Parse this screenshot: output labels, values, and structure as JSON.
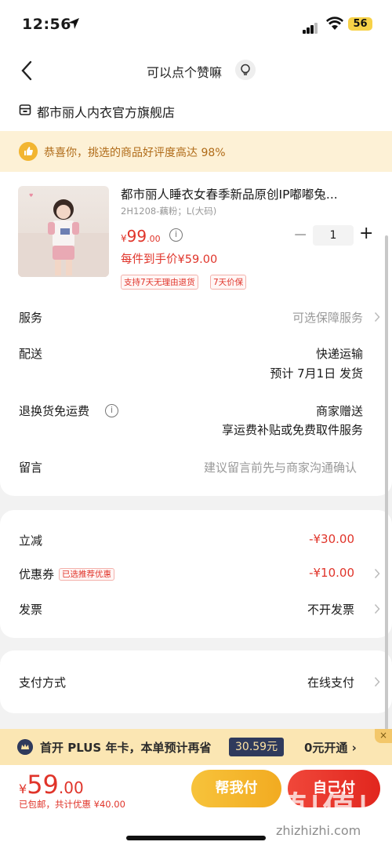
{
  "status": {
    "time": "12:56",
    "battery": "56"
  },
  "nav": {
    "title": "可以点个赞嘛"
  },
  "shop": {
    "name": "都市丽人内衣官方旗舰店"
  },
  "notice": {
    "text": "恭喜你，挑选的商品好评度高达 98%"
  },
  "product": {
    "title": "都市丽人睡衣女春季新品原创IP嘟嘟兔...",
    "sku": "2H1208-藕粉；L(大码)",
    "price_symbol": "¥",
    "price_int": "99",
    "price_dec": ".00",
    "quantity": "1",
    "each_price": "每件到手价¥59.00",
    "tags": [
      "支持7天无理由退货",
      "7天价保"
    ]
  },
  "rows": {
    "service_label": "服务",
    "service_value": "可选保障服务",
    "delivery_label": "配送",
    "delivery_value": "快递运输",
    "delivery_date": "预计 7月1日 发货",
    "return_label": "退换货免运费",
    "return_value": "商家赠送",
    "return_value2": "享运费补贴或免费取件服务",
    "note_label": "留言",
    "note_placeholder": "建议留言前先与商家沟通确认"
  },
  "discounts": {
    "reduce_label": "立减",
    "reduce_value": "-¥30.00",
    "coupon_label": "优惠券",
    "coupon_tag": "已选推荐优惠",
    "coupon_value": "-¥10.00",
    "invoice_label": "发票",
    "invoice_value": "不开发票"
  },
  "payment": {
    "label": "支付方式",
    "value": "在线支付"
  },
  "plus": {
    "text": "首开 PLUS 年卡，本单预计再省",
    "save": "30.59元",
    "open": "0元开通 ›",
    "close": "×"
  },
  "bottom": {
    "symbol": "¥",
    "total_int": "59",
    "total_dec": ".00",
    "sub": "已包邮，共计优惠 ¥40.00",
    "help_btn": "帮我付",
    "pay_btn": "自己付",
    "watermark": "值|值|值",
    "watermark_url": "zhizhizhi.com"
  },
  "colors": {
    "accent": "#e0342a",
    "plus_bg": "#fbe6b3",
    "notice_bg": "#fdf1d6"
  }
}
